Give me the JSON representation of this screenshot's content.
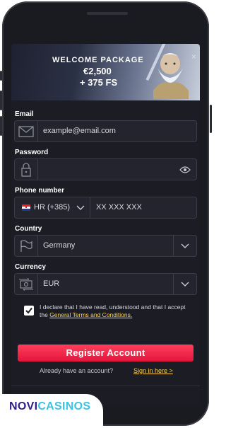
{
  "banner": {
    "title": "WELCOME PACKAGE",
    "amount": "€2,500",
    "spins": "+ 375 FS",
    "close": "×"
  },
  "form": {
    "email": {
      "label": "Email",
      "placeholder": "example@email.com"
    },
    "password": {
      "label": "Password",
      "value": ""
    },
    "phone": {
      "label": "Phone number",
      "prefix": "HR (+385)",
      "placeholder": "XX XXX XXX"
    },
    "country": {
      "label": "Country",
      "value": "Germany"
    },
    "currency": {
      "label": "Currency",
      "value": "EUR"
    },
    "declaration": {
      "checked": true,
      "text": "I declare that I have read, understood and that I accept the ",
      "link": "General Terms and Conditions."
    },
    "register_label": "Register Account",
    "already_text": "Already have an account?",
    "signin_label": "Sign in here >"
  },
  "brand": {
    "part1": "NOVI",
    "part2": "CASINOS"
  },
  "colors": {
    "accent": "#e4153b",
    "link": "#ffd24a",
    "background": "#1b1c24"
  }
}
